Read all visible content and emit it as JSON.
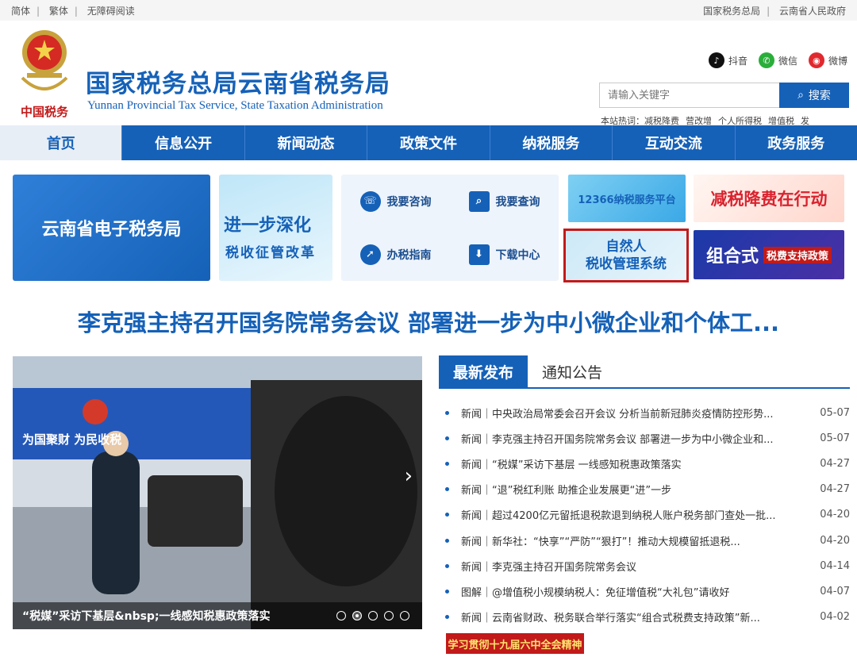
{
  "topbar": {
    "left": [
      "简体",
      "繁体",
      "无障碍阅读"
    ],
    "right": [
      "国家税务总局",
      "云南省人民政府"
    ]
  },
  "header": {
    "title": "国家税务总局云南省税务局",
    "subtitle": "Yunnan Provincial Tax Service, State Taxation Administration",
    "logo_text": "中国税务",
    "social": [
      {
        "label": "抖音",
        "icon": "douyin-icon",
        "color": "#111111",
        "glyph": "♪"
      },
      {
        "label": "微信",
        "icon": "wechat-icon",
        "color": "#2aae3a",
        "glyph": "✆"
      },
      {
        "label": "微博",
        "icon": "weibo-icon",
        "color": "#e0292e",
        "glyph": "◉"
      }
    ]
  },
  "search": {
    "placeholder": "请输入关键字",
    "button_label": "搜索",
    "hot_label": "本站热词：",
    "hot_words": [
      "减税降费",
      "营改增",
      "个人所得税",
      "增值税",
      "发"
    ]
  },
  "nav": {
    "items": [
      "首页",
      "信息公开",
      "新闻动态",
      "政策文件",
      "纳税服务",
      "互动交流",
      "政务服务"
    ],
    "active_index": 0
  },
  "tiles": {
    "etax": "云南省电子税务局",
    "reform_line1": "进一步深化",
    "reform_line2": "税收征管改革",
    "consult": "我要咨询",
    "query": "我要查询",
    "guide": "办税指南",
    "download": "下载中心",
    "hotline": "12366纳税服务平台",
    "taxcut": "减税降费在行动",
    "natural_line1": "自然人",
    "natural_line2": "税收管理系统",
    "combo_main": "组合式",
    "combo_tag": "税费支持政策"
  },
  "headline": "李克强主持召开国务院常务会议 部署进一步为中小微企业和个体工...",
  "carousel": {
    "caption": "“税媒”采访下基层&nbsp;一线感知税惠政策落实",
    "slide_text": "为国聚财 为民收税",
    "dots": 5,
    "active_dot": 1
  },
  "news": {
    "tab_latest": "最新发布",
    "tab_notice": "通知公告",
    "items": [
      {
        "text": "新闻｜中央政治局常委会召开会议 分析当前新冠肺炎疫情防控形势...",
        "date": "05-07"
      },
      {
        "text": "新闻｜李克强主持召开国务院常务会议 部署进一步为中小微企业和...",
        "date": "05-07"
      },
      {
        "text": "新闻｜“税媒”采访下基层 一线感知税惠政策落实",
        "date": "04-27"
      },
      {
        "text": "新闻｜“退”税红利账 助推企业发展更“进”一步",
        "date": "04-27"
      },
      {
        "text": "新闻｜超过4200亿元留抵退税款退到纳税人账户税务部门查处一批...",
        "date": "04-20"
      },
      {
        "text": "新闻｜新华社：“快享”“严防”“狠打”！推动大规模留抵退税...",
        "date": "04-20"
      },
      {
        "text": "新闻｜李克强主持召开国务院常务会议",
        "date": "04-14"
      },
      {
        "text": "图解｜@增值税小规模纳税人：免征增值税“大礼包”请收好",
        "date": "04-07"
      },
      {
        "text": "新闻｜云南省财政、税务联合举行落实“组合式税费支持政策”新...",
        "date": "04-02"
      }
    ]
  },
  "banner": "学习贯彻十九届六中全会精神"
}
